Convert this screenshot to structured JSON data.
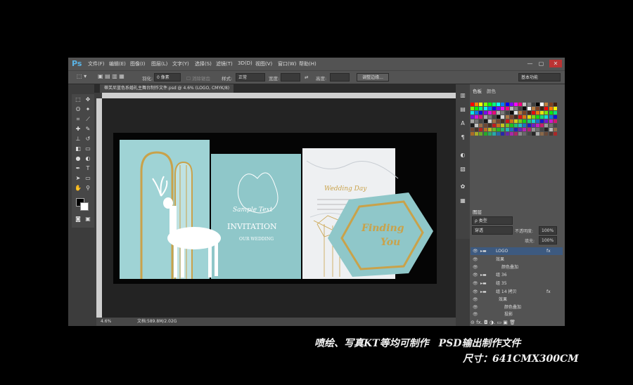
{
  "app": {
    "logo": "Ps"
  },
  "menu": [
    "文件(F)",
    "编辑(E)",
    "图像(I)",
    "图层(L)",
    "文字(Y)",
    "选择(S)",
    "滤镜(T)",
    "3D(D)",
    "视图(V)",
    "窗口(W)",
    "帮助(H)"
  ],
  "window_controls": [
    "—",
    "▢",
    "✕"
  ],
  "options": {
    "feather_label": "羽化:",
    "feather_value": "0 像素",
    "antialias": "消除锯齿",
    "style_label": "样式:",
    "style_value": "正常",
    "width_label": "宽度:",
    "height_label": "高度:",
    "refine_button": "调整边缘...",
    "workspace": "基本功能"
  },
  "document": {
    "tab_title": "蒂芙尼蓝色系婚礼主舞台制作文件.psd @ 4.6% (LOGO, CMYK/8)"
  },
  "status": {
    "zoom": "4.6%",
    "doc": "文档:589.8M/2.02G"
  },
  "artwork": {
    "sample_text": "Sample Text",
    "invitation": "INVITATION",
    "our_wedding": "OUR WEDDING",
    "wedding_day": "Wedding Day",
    "finding": "Finding",
    "you": "You"
  },
  "color_panel": {
    "tabs": [
      "色板",
      "颜色"
    ]
  },
  "layers_panel": {
    "tabs": [
      "图层"
    ],
    "kind_filter": "ρ 类型",
    "blend_mode": "穿透",
    "opacity_label": "不透明度:",
    "opacity_value": "100%",
    "fill_label": "填充:",
    "fill_value": "100%",
    "layers": [
      {
        "name": "LOGO",
        "fx": "fx",
        "selected": true
      },
      {
        "name": "效果",
        "fx": ""
      },
      {
        "name": "颜色叠加",
        "fx": ""
      },
      {
        "name": "组 36",
        "fx": ""
      },
      {
        "name": "组 35",
        "fx": ""
      },
      {
        "name": "组 14 拷贝",
        "fx": "fx"
      },
      {
        "name": "效果",
        "fx": ""
      },
      {
        "name": "颜色叠加",
        "fx": ""
      },
      {
        "name": "投影",
        "fx": ""
      }
    ],
    "footer": "⊝ fx. ◘ ◑. ▭ ▣ 🗑"
  },
  "caption": {
    "line1": "喷绘、写真KT等均可制作　PSD输出制作文件",
    "line2": "尺寸：641CMX300CM"
  },
  "colors": {
    "accent_teal": "#9ccfd1",
    "gold": "#c9a24a",
    "panel": "#535353"
  }
}
